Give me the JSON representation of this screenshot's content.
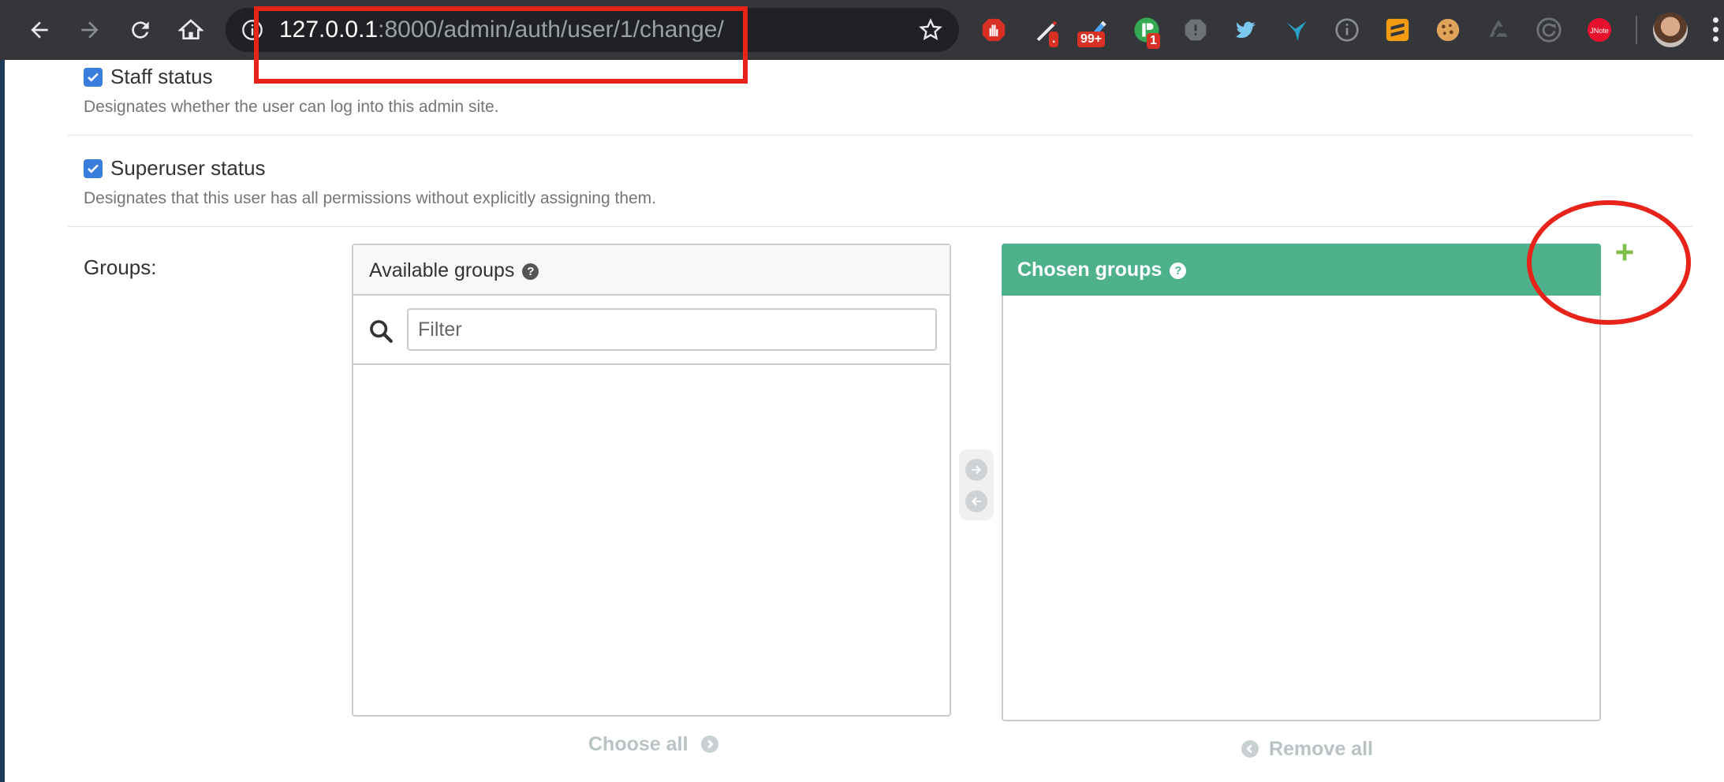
{
  "browser": {
    "url_host": "127.0.0.1",
    "url_rest": ":8000/admin/auth/user/1/change/",
    "extensions": [
      {
        "icon": "stop-hand-icon",
        "badge": ""
      },
      {
        "icon": "pen-tool-icon",
        "badge": "."
      },
      {
        "icon": "highlighter-icon",
        "badge": "99+"
      },
      {
        "icon": "reader-icon",
        "badge": "1"
      },
      {
        "icon": "octagon-icon",
        "badge": ""
      },
      {
        "icon": "twitter-bird-icon",
        "badge": ""
      },
      {
        "icon": "hummingbird-icon",
        "badge": ""
      },
      {
        "icon": "info-icon",
        "badge": ""
      },
      {
        "icon": "sublime-icon",
        "badge": ""
      },
      {
        "icon": "cookie-icon",
        "badge": ""
      },
      {
        "icon": "recycle-icon",
        "badge": ""
      },
      {
        "icon": "refresh-circle-icon",
        "badge": ""
      },
      {
        "icon": "jnote-icon",
        "badge": ""
      }
    ],
    "jnote_label": "JNote"
  },
  "form": {
    "staff": {
      "label": "Staff status",
      "help": "Designates whether the user can log into this admin site.",
      "checked": true
    },
    "superuser": {
      "label": "Superuser status",
      "help": "Designates that this user has all permissions without explicitly assigning them.",
      "checked": true
    },
    "groups": {
      "label": "Groups:",
      "available_title": "Available groups",
      "filter_placeholder": "Filter",
      "chosen_title": "Chosen groups",
      "choose_all": "Choose all",
      "remove_all": "Remove all",
      "add_label": "+"
    }
  },
  "colors": {
    "chosen_header": "#4db18b",
    "annotation": "#e8231a",
    "checkbox": "#3b7ddd",
    "add_green": "#7dbf4a"
  }
}
